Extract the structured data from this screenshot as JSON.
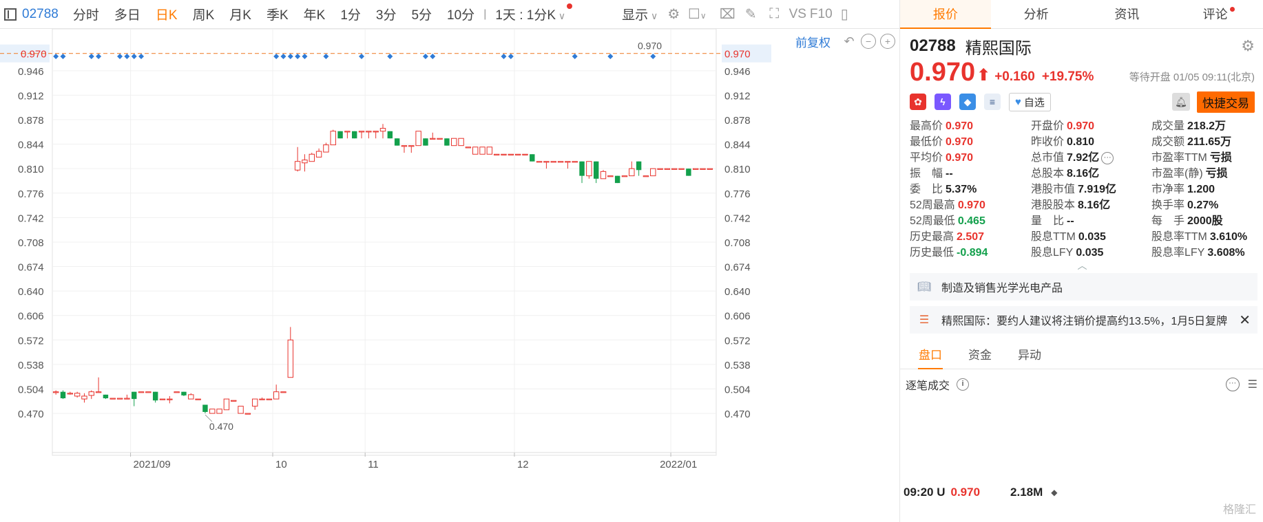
{
  "toolbar": {
    "code": "02788",
    "periods": [
      {
        "label": "分时",
        "active": false
      },
      {
        "label": "多日",
        "active": false
      },
      {
        "label": "日K",
        "active": true
      },
      {
        "label": "周K",
        "active": false
      },
      {
        "label": "月K",
        "active": false
      },
      {
        "label": "季K",
        "active": false
      },
      {
        "label": "年K",
        "active": false
      },
      {
        "label": "1分",
        "active": false
      },
      {
        "label": "3分",
        "active": false
      },
      {
        "label": "5分",
        "active": false
      },
      {
        "label": "10分",
        "active": false
      }
    ],
    "interval": "1天 : 1分K",
    "display": "显示",
    "vs": "VS",
    "f10": "F10"
  },
  "chart_toolbar": {
    "adjust": "前复权"
  },
  "chart_data": {
    "type": "candlestick",
    "y_ticks": [
      "0.946",
      "0.912",
      "0.878",
      "0.844",
      "0.810",
      "0.776",
      "0.742",
      "0.708",
      "0.674",
      "0.640",
      "0.606",
      "0.572",
      "0.538",
      "0.504",
      "0.470"
    ],
    "ylim": [
      0.45,
      0.985
    ],
    "x_labels": [
      "2021/09",
      "10",
      "11",
      "12",
      "2022/01"
    ],
    "x_label_index": [
      11,
      31,
      44,
      65,
      87
    ],
    "current_price_label": "0.970",
    "current_price": 0.97,
    "high_annotation": "0.970",
    "low_annotation": "0.470",
    "dividend_marker_index": [
      0,
      1,
      5,
      6,
      9,
      10,
      11,
      12,
      31,
      32,
      33,
      34,
      35,
      38,
      43,
      47,
      52,
      53,
      63,
      64,
      73,
      78,
      84
    ],
    "candles": [
      {
        "o": 0.5,
        "h": 0.502,
        "l": 0.496,
        "c": 0.5
      },
      {
        "o": 0.5,
        "h": 0.502,
        "l": 0.49,
        "c": 0.491
      },
      {
        "o": 0.498,
        "h": 0.5,
        "l": 0.496,
        "c": 0.498
      },
      {
        "o": 0.494,
        "h": 0.5,
        "l": 0.492,
        "c": 0.498
      },
      {
        "o": 0.49,
        "h": 0.498,
        "l": 0.485,
        "c": 0.494
      },
      {
        "o": 0.495,
        "h": 0.502,
        "l": 0.49,
        "c": 0.5
      },
      {
        "o": 0.5,
        "h": 0.52,
        "l": 0.5,
        "c": 0.5
      },
      {
        "o": 0.496,
        "h": 0.496,
        "l": 0.49,
        "c": 0.491
      },
      {
        "o": 0.491,
        "h": 0.491,
        "l": 0.491,
        "c": 0.491
      },
      {
        "o": 0.491,
        "h": 0.491,
        "l": 0.491,
        "c": 0.491
      },
      {
        "o": 0.491,
        "h": 0.496,
        "l": 0.491,
        "c": 0.491
      },
      {
        "o": 0.5,
        "h": 0.5,
        "l": 0.48,
        "c": 0.49
      },
      {
        "o": 0.5,
        "h": 0.5,
        "l": 0.5,
        "c": 0.5
      },
      {
        "o": 0.5,
        "h": 0.5,
        "l": 0.5,
        "c": 0.5
      },
      {
        "o": 0.5,
        "h": 0.5,
        "l": 0.485,
        "c": 0.488
      },
      {
        "o": 0.49,
        "h": 0.49,
        "l": 0.49,
        "c": 0.49
      },
      {
        "o": 0.49,
        "h": 0.494,
        "l": 0.484,
        "c": 0.49
      },
      {
        "o": 0.5,
        "h": 0.5,
        "l": 0.5,
        "c": 0.5
      },
      {
        "o": 0.5,
        "h": 0.5,
        "l": 0.494,
        "c": 0.495
      },
      {
        "o": 0.49,
        "h": 0.498,
        "l": 0.49,
        "c": 0.496
      },
      {
        "o": 0.49,
        "h": 0.49,
        "l": 0.49,
        "c": 0.49
      },
      {
        "o": 0.482,
        "h": 0.482,
        "l": 0.47,
        "c": 0.472
      },
      {
        "o": 0.47,
        "h": 0.476,
        "l": 0.47,
        "c": 0.476
      },
      {
        "o": 0.47,
        "h": 0.476,
        "l": 0.47,
        "c": 0.476
      },
      {
        "o": 0.475,
        "h": 0.49,
        "l": 0.475,
        "c": 0.49
      },
      {
        "o": 0.488,
        "h": 0.488,
        "l": 0.488,
        "c": 0.488
      },
      {
        "o": 0.47,
        "h": 0.48,
        "l": 0.47,
        "c": 0.48
      },
      {
        "o": 0.47,
        "h": 0.47,
        "l": 0.47,
        "c": 0.47
      },
      {
        "o": 0.48,
        "h": 0.49,
        "l": 0.475,
        "c": 0.49
      },
      {
        "o": 0.49,
        "h": 0.492,
        "l": 0.49,
        "c": 0.49
      },
      {
        "o": 0.49,
        "h": 0.49,
        "l": 0.49,
        "c": 0.49
      },
      {
        "o": 0.49,
        "h": 0.51,
        "l": 0.49,
        "c": 0.5
      },
      {
        "o": 0.5,
        "h": 0.5,
        "l": 0.5,
        "c": 0.5
      },
      {
        "o": 0.52,
        "h": 0.59,
        "l": 0.52,
        "c": 0.572
      },
      {
        "o": 0.808,
        "h": 0.84,
        "l": 0.806,
        "c": 0.82
      },
      {
        "o": 0.818,
        "h": 0.83,
        "l": 0.806,
        "c": 0.822
      },
      {
        "o": 0.82,
        "h": 0.832,
        "l": 0.82,
        "c": 0.83
      },
      {
        "o": 0.826,
        "h": 0.838,
        "l": 0.826,
        "c": 0.834
      },
      {
        "o": 0.833,
        "h": 0.846,
        "l": 0.833,
        "c": 0.843
      },
      {
        "o": 0.843,
        "h": 0.864,
        "l": 0.843,
        "c": 0.862
      },
      {
        "o": 0.862,
        "h": 0.862,
        "l": 0.852,
        "c": 0.852
      },
      {
        "o": 0.862,
        "h": 0.862,
        "l": 0.852,
        "c": 0.862
      },
      {
        "o": 0.862,
        "h": 0.862,
        "l": 0.852,
        "c": 0.852
      },
      {
        "o": 0.862,
        "h": 0.862,
        "l": 0.852,
        "c": 0.862
      },
      {
        "o": 0.862,
        "h": 0.862,
        "l": 0.852,
        "c": 0.862
      },
      {
        "o": 0.862,
        "h": 0.862,
        "l": 0.852,
        "c": 0.862
      },
      {
        "o": 0.862,
        "h": 0.872,
        "l": 0.852,
        "c": 0.866
      },
      {
        "o": 0.862,
        "h": 0.862,
        "l": 0.852,
        "c": 0.852
      },
      {
        "o": 0.852,
        "h": 0.852,
        "l": 0.842,
        "c": 0.842
      },
      {
        "o": 0.842,
        "h": 0.842,
        "l": 0.832,
        "c": 0.842
      },
      {
        "o": 0.842,
        "h": 0.842,
        "l": 0.832,
        "c": 0.842
      },
      {
        "o": 0.842,
        "h": 0.862,
        "l": 0.842,
        "c": 0.862
      },
      {
        "o": 0.852,
        "h": 0.852,
        "l": 0.842,
        "c": 0.842
      },
      {
        "o": 0.852,
        "h": 0.86,
        "l": 0.852,
        "c": 0.852
      },
      {
        "o": 0.852,
        "h": 0.852,
        "l": 0.852,
        "c": 0.852
      },
      {
        "o": 0.852,
        "h": 0.852,
        "l": 0.842,
        "c": 0.842
      },
      {
        "o": 0.842,
        "h": 0.852,
        "l": 0.842,
        "c": 0.852
      },
      {
        "o": 0.842,
        "h": 0.852,
        "l": 0.842,
        "c": 0.852
      },
      {
        "o": 0.84,
        "h": 0.84,
        "l": 0.84,
        "c": 0.84
      },
      {
        "o": 0.83,
        "h": 0.84,
        "l": 0.83,
        "c": 0.84
      },
      {
        "o": 0.83,
        "h": 0.84,
        "l": 0.83,
        "c": 0.84
      },
      {
        "o": 0.83,
        "h": 0.84,
        "l": 0.83,
        "c": 0.84
      },
      {
        "o": 0.83,
        "h": 0.83,
        "l": 0.83,
        "c": 0.83
      },
      {
        "o": 0.83,
        "h": 0.83,
        "l": 0.83,
        "c": 0.83
      },
      {
        "o": 0.83,
        "h": 0.83,
        "l": 0.83,
        "c": 0.83
      },
      {
        "o": 0.83,
        "h": 0.83,
        "l": 0.83,
        "c": 0.83
      },
      {
        "o": 0.83,
        "h": 0.83,
        "l": 0.83,
        "c": 0.83
      },
      {
        "o": 0.83,
        "h": 0.83,
        "l": 0.82,
        "c": 0.82
      },
      {
        "o": 0.82,
        "h": 0.82,
        "l": 0.82,
        "c": 0.82
      },
      {
        "o": 0.82,
        "h": 0.82,
        "l": 0.81,
        "c": 0.82
      },
      {
        "o": 0.82,
        "h": 0.82,
        "l": 0.82,
        "c": 0.82
      },
      {
        "o": 0.82,
        "h": 0.82,
        "l": 0.82,
        "c": 0.82
      },
      {
        "o": 0.82,
        "h": 0.82,
        "l": 0.81,
        "c": 0.82
      },
      {
        "o": 0.82,
        "h": 0.82,
        "l": 0.82,
        "c": 0.82
      },
      {
        "o": 0.82,
        "h": 0.82,
        "l": 0.79,
        "c": 0.8
      },
      {
        "o": 0.8,
        "h": 0.82,
        "l": 0.796,
        "c": 0.82
      },
      {
        "o": 0.82,
        "h": 0.82,
        "l": 0.79,
        "c": 0.796
      },
      {
        "o": 0.796,
        "h": 0.808,
        "l": 0.796,
        "c": 0.806
      },
      {
        "o": 0.8,
        "h": 0.8,
        "l": 0.8,
        "c": 0.8
      },
      {
        "o": 0.8,
        "h": 0.8,
        "l": 0.79,
        "c": 0.79
      },
      {
        "o": 0.8,
        "h": 0.8,
        "l": 0.8,
        "c": 0.8
      },
      {
        "o": 0.8,
        "h": 0.82,
        "l": 0.8,
        "c": 0.81
      },
      {
        "o": 0.82,
        "h": 0.82,
        "l": 0.8,
        "c": 0.808
      },
      {
        "o": 0.8,
        "h": 0.8,
        "l": 0.8,
        "c": 0.8
      },
      {
        "o": 0.8,
        "h": 0.81,
        "l": 0.8,
        "c": 0.81
      },
      {
        "o": 0.81,
        "h": 0.81,
        "l": 0.81,
        "c": 0.81
      },
      {
        "o": 0.81,
        "h": 0.81,
        "l": 0.81,
        "c": 0.81
      },
      {
        "o": 0.81,
        "h": 0.81,
        "l": 0.81,
        "c": 0.81
      },
      {
        "o": 0.81,
        "h": 0.81,
        "l": 0.81,
        "c": 0.81
      },
      {
        "o": 0.81,
        "h": 0.81,
        "l": 0.8,
        "c": 0.8
      },
      {
        "o": 0.81,
        "h": 0.81,
        "l": 0.81,
        "c": 0.81
      },
      {
        "o": 0.81,
        "h": 0.81,
        "l": 0.81,
        "c": 0.81
      },
      {
        "o": 0.81,
        "h": 0.81,
        "l": 0.81,
        "c": 0.81
      }
    ],
    "colors": {
      "up": "#e8332d",
      "down": "#13a04c",
      "marker": "#2f7bd6",
      "price_line": "#f0883a"
    }
  },
  "tabs": [
    {
      "label": "报价",
      "active": true
    },
    {
      "label": "分析",
      "active": false
    },
    {
      "label": "资讯",
      "active": false
    },
    {
      "label": "评论",
      "active": false,
      "dot": true
    }
  ],
  "quote": {
    "code": "02788",
    "name": "精熙国际",
    "price": "0.970",
    "arrow": "⬆",
    "change": "+0.160",
    "change_pct": "+19.75%",
    "status": "等待开盘 01/05 09:11(北京)",
    "favorite": "自选",
    "trade": "快捷交易"
  },
  "stats": [
    {
      "label": "最高价",
      "value": "0.970",
      "color": "red"
    },
    {
      "label": "开盘价",
      "value": "0.970",
      "color": "red"
    },
    {
      "label": "成交量",
      "value": "218.2万",
      "color": ""
    },
    {
      "label": "最低价",
      "value": "0.970",
      "color": "red"
    },
    {
      "label": "昨收价",
      "value": "0.810",
      "color": ""
    },
    {
      "label": "成交额",
      "value": "211.65万",
      "color": ""
    },
    {
      "label": "平均价",
      "value": "0.970",
      "color": "red"
    },
    {
      "label": "总市值",
      "value": "7.92亿",
      "color": "",
      "more": true
    },
    {
      "label": "市盈率TTM",
      "value": "亏损",
      "color": ""
    },
    {
      "label": "振　幅",
      "value": "--",
      "color": ""
    },
    {
      "label": "总股本",
      "value": "8.16亿",
      "color": ""
    },
    {
      "label": "市盈率(静)",
      "value": "亏损",
      "color": ""
    },
    {
      "label": "委　比",
      "value": "5.37%",
      "color": ""
    },
    {
      "label": "港股市值",
      "value": "7.919亿",
      "color": ""
    },
    {
      "label": "市净率",
      "value": "1.200",
      "color": ""
    },
    {
      "label": "52周最高",
      "value": "0.970",
      "color": "red"
    },
    {
      "label": "港股股本",
      "value": "8.16亿",
      "color": ""
    },
    {
      "label": "换手率",
      "value": "0.27%",
      "color": ""
    },
    {
      "label": "52周最低",
      "value": "0.465",
      "color": "green"
    },
    {
      "label": "量　比",
      "value": "--",
      "color": ""
    },
    {
      "label": "每　手",
      "value": "2000股",
      "color": ""
    },
    {
      "label": "历史最高",
      "value": "2.507",
      "color": "red"
    },
    {
      "label": "股息TTM",
      "value": "0.035",
      "color": ""
    },
    {
      "label": "股息率TTM",
      "value": "3.610%",
      "color": ""
    },
    {
      "label": "历史最低",
      "value": "-0.894",
      "color": "green"
    },
    {
      "label": "股息LFY",
      "value": "0.035",
      "color": ""
    },
    {
      "label": "股息率LFY",
      "value": "3.608%",
      "color": ""
    }
  ],
  "business": "制造及销售光学光电产品",
  "news": "精熙国际：要约人建议将注销价提高约13.5%，1月5日复牌",
  "subtabs": [
    {
      "label": "盘口",
      "active": true
    },
    {
      "label": "资金",
      "active": false
    },
    {
      "label": "异动",
      "active": false
    }
  ],
  "ticks": {
    "title": "逐笔成交",
    "rows": [
      {
        "time": "09:20 U",
        "price": "0.970",
        "volume": "2.18M",
        "dir": "◆"
      }
    ]
  },
  "watermark": "格隆汇"
}
